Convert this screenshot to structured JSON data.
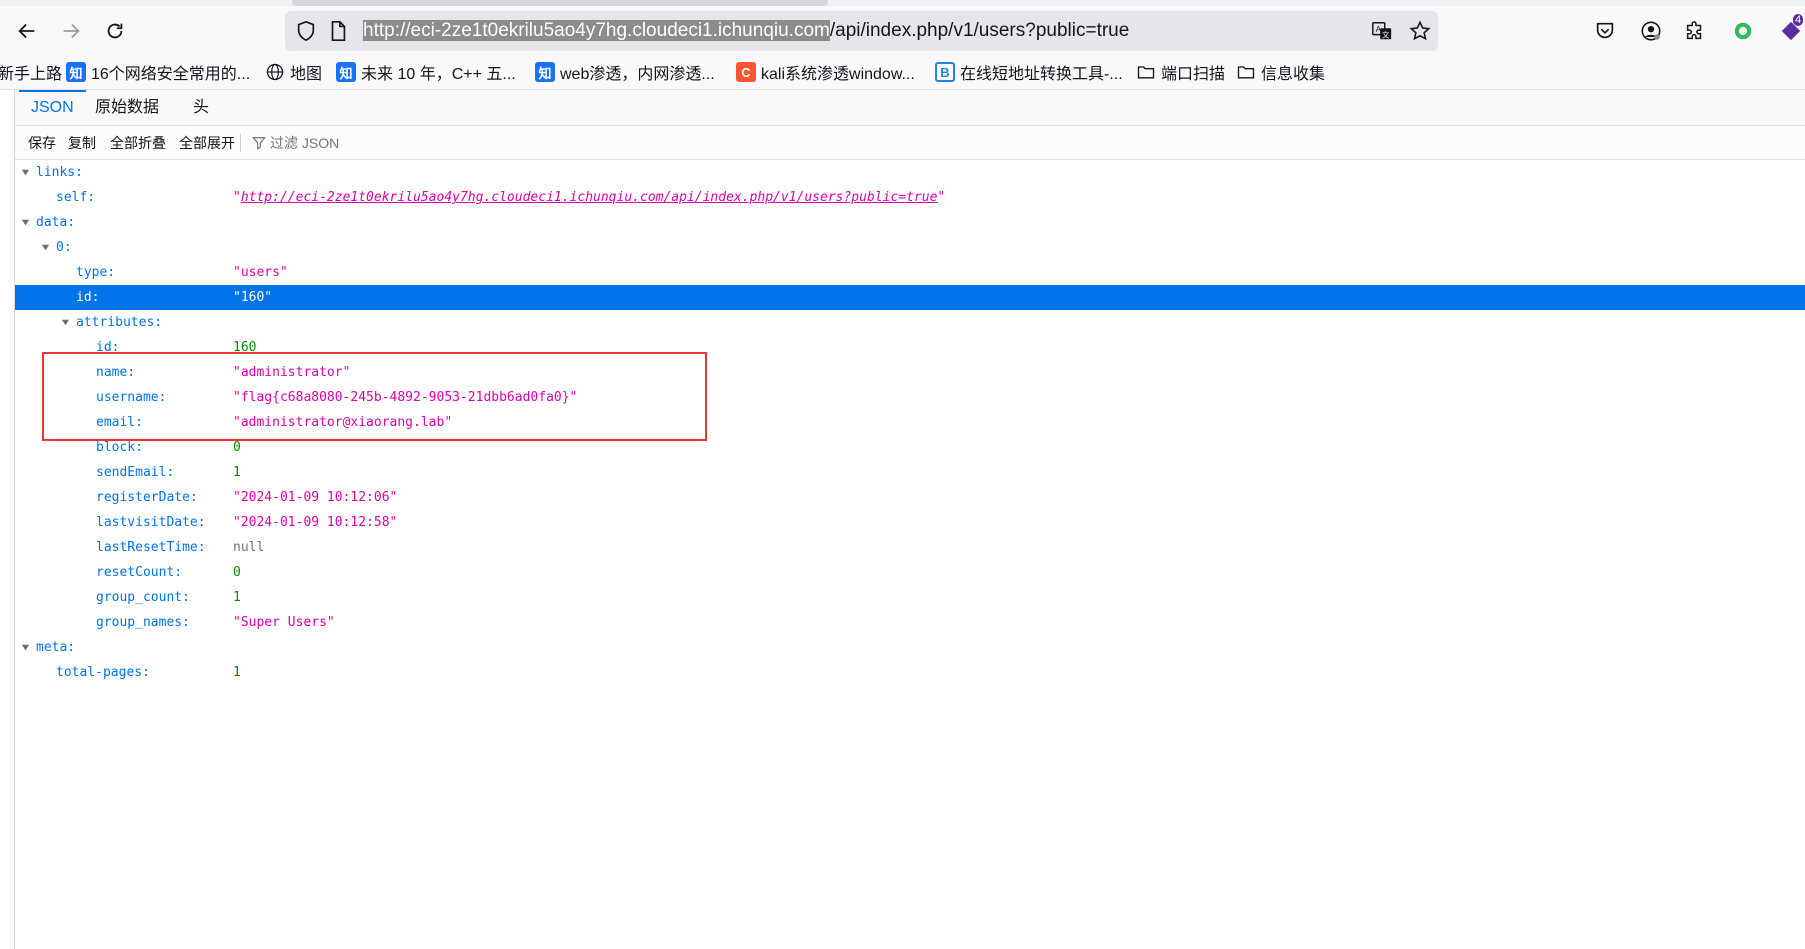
{
  "browser": {
    "url_highlighted": "http://eci-2ze1t0ekrilu5ao4y7hg.cloudeci1.ichunqiu.com",
    "url_rest": "/api/index.php/v1/users?public=true",
    "profile_badge": "4"
  },
  "bookmarks": [
    {
      "label": "新手上路",
      "icon": "none"
    },
    {
      "label": "16个网络安全常用的...",
      "icon": "zhihu",
      "glyph": "知"
    },
    {
      "label": "地图",
      "icon": "globe"
    },
    {
      "label": "未来 10 年，C++ 五...",
      "icon": "zhihu",
      "glyph": "知"
    },
    {
      "label": "web渗透，内网渗透...",
      "icon": "zhihu",
      "glyph": "知"
    },
    {
      "label": "kali系统渗透window...",
      "icon": "csdn",
      "glyph": "C"
    },
    {
      "label": "在线短地址转换工具-...",
      "icon": "b-logo",
      "glyph": "B"
    },
    {
      "label": "端口扫描",
      "icon": "folder"
    },
    {
      "label": "信息收集",
      "icon": "folder"
    }
  ],
  "viewer": {
    "tabs": [
      "JSON",
      "原始数据",
      "头"
    ],
    "active_tab": "JSON",
    "toolbar": {
      "save": "保存",
      "copy": "复制",
      "collapse_all": "全部折叠",
      "expand_all": "全部展开",
      "filter_placeholder": "过滤 JSON"
    }
  },
  "json_tree": {
    "links_key": "links:",
    "self_key": "self:",
    "self_value": "\"http://eci-2ze1t0ekrilu5ao4y7hg.cloudeci1.ichunqiu.com/api/index.php/v1/users?public=true\"",
    "data_key": "data:",
    "item0_key": "0:",
    "type_key": "type:",
    "type_value": "\"users\"",
    "id_key": "id:",
    "id_value": "\"160\"",
    "attributes_key": "attributes:",
    "attributes": [
      {
        "key": "id:",
        "value": "160",
        "kind": "num"
      },
      {
        "key": "name:",
        "value": "\"administrator\"",
        "kind": "str"
      },
      {
        "key": "username:",
        "value": "\"flag{c68a8080-245b-4892-9053-21dbb6ad0fa0}\"",
        "kind": "str"
      },
      {
        "key": "email:",
        "value": "\"administrator@xiaorang.lab\"",
        "kind": "str"
      },
      {
        "key": "block:",
        "value": "0",
        "kind": "num"
      },
      {
        "key": "sendEmail:",
        "value": "1",
        "kind": "num"
      },
      {
        "key": "registerDate:",
        "value": "\"2024-01-09 10:12:06\"",
        "kind": "str"
      },
      {
        "key": "lastvisitDate:",
        "value": "\"2024-01-09 10:12:58\"",
        "kind": "str"
      },
      {
        "key": "lastResetTime:",
        "value": "null",
        "kind": "null"
      },
      {
        "key": "resetCount:",
        "value": "0",
        "kind": "num"
      },
      {
        "key": "group_count:",
        "value": "1",
        "kind": "num"
      },
      {
        "key": "group_names:",
        "value": "\"Super Users\"",
        "kind": "str"
      }
    ],
    "meta_key": "meta:",
    "total_pages_key": "total-pages:",
    "total_pages_value": "1"
  },
  "colors": {
    "accent": "#0074e8",
    "string": "#dd00a9",
    "number": "#058b00",
    "highlight_box": "#e53935"
  }
}
